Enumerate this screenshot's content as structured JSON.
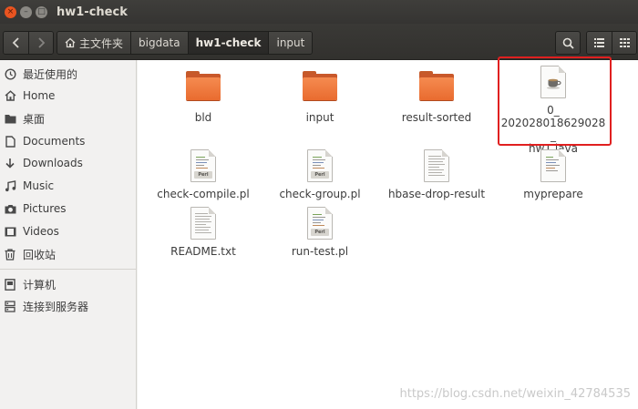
{
  "window": {
    "title": "hw1-check"
  },
  "toolbar": {
    "back_icon": "chevron-left-icon",
    "forward_icon": "chevron-right-icon",
    "breadcrumbs": [
      {
        "label": "主文件夹",
        "icon": "home-icon"
      },
      {
        "label": "bigdata"
      },
      {
        "label": "hw1-check",
        "active": true
      },
      {
        "label": "input"
      }
    ],
    "search_icon": "search-icon",
    "list_view_icon": "list-view-icon",
    "grid_view_icon": "grid-view-icon"
  },
  "sidebar": {
    "items": [
      {
        "label": "最近使用的",
        "icon": "clock-icon"
      },
      {
        "label": "Home",
        "icon": "home-icon"
      },
      {
        "label": "桌面",
        "icon": "desktop-icon"
      },
      {
        "label": "Documents",
        "icon": "document-icon"
      },
      {
        "label": "Downloads",
        "icon": "download-icon"
      },
      {
        "label": "Music",
        "icon": "music-icon"
      },
      {
        "label": "Pictures",
        "icon": "camera-icon"
      },
      {
        "label": "Videos",
        "icon": "video-icon"
      },
      {
        "label": "回收站",
        "icon": "trash-icon"
      },
      {
        "label": "计算机",
        "icon": "computer-icon"
      },
      {
        "label": "连接到服务器",
        "icon": "server-icon"
      }
    ]
  },
  "files": [
    {
      "name": "bld",
      "type": "folder"
    },
    {
      "name": "input",
      "type": "folder"
    },
    {
      "name": "result-sorted",
      "type": "folder"
    },
    {
      "name": "0_\n202028018629028_\nhw1.java",
      "type": "java"
    },
    {
      "name": "check-compile.pl",
      "type": "perl"
    },
    {
      "name": "check-group.pl",
      "type": "perl"
    },
    {
      "name": "hbase-drop-result",
      "type": "text"
    },
    {
      "name": "myprepare",
      "type": "script"
    },
    {
      "name": "README.txt",
      "type": "text"
    },
    {
      "name": "run-test.pl",
      "type": "perl"
    }
  ],
  "watermark": "https://blog.csdn.net/weixin_42784535",
  "colors": {
    "folder_orange": "#f07a3c",
    "highlight_red": "#e02020",
    "ubuntu_close": "#e95420"
  }
}
